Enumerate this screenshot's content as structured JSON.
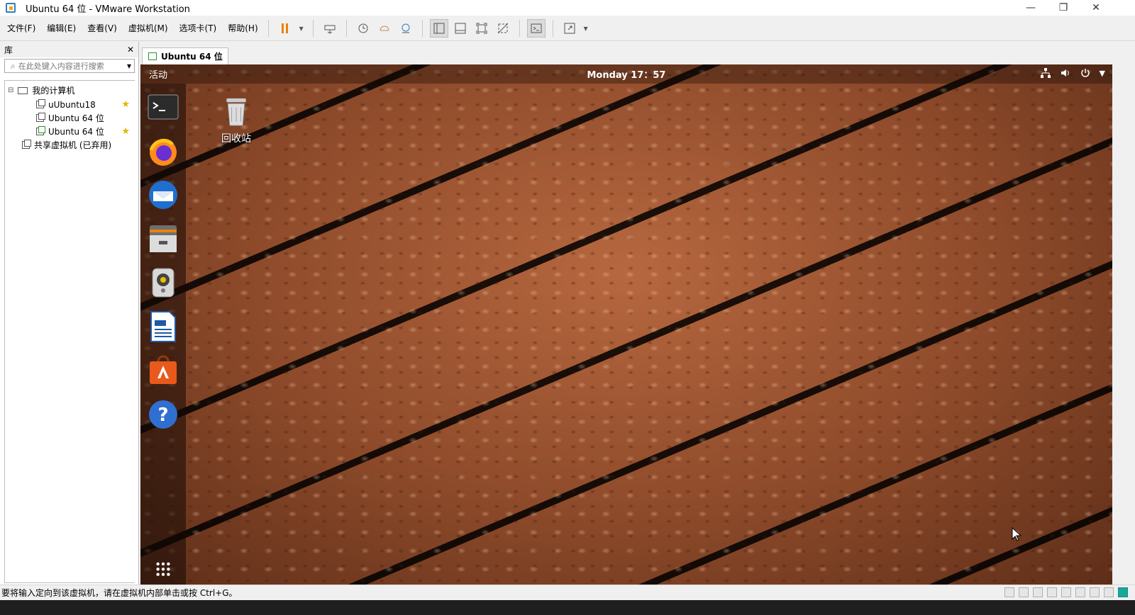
{
  "window": {
    "title": "Ubuntu 64 位 - VMware Workstation"
  },
  "menu": [
    "文件(F)",
    "编辑(E)",
    "查看(V)",
    "虚拟机(M)",
    "选项卡(T)",
    "帮助(H)"
  ],
  "library": {
    "title": "库",
    "search_placeholder": "在此处键入内容进行搜索",
    "tree": {
      "root": "我的计算机",
      "vms": [
        "uUbuntu18",
        "Ubuntu 64 位",
        "Ubuntu 64 位"
      ],
      "shared": "共享虚拟机 (已弃用)"
    }
  },
  "vm_tab": {
    "label": "Ubuntu 64 位"
  },
  "guest": {
    "activities": "活动",
    "clock": "Monday 17：57",
    "desktop_icon_label": "回收站",
    "dock_apps": [
      "terminal-icon",
      "firefox-icon",
      "thunderbird-icon",
      "files-icon",
      "rhythmbox-icon",
      "libreoffice-writer-icon",
      "ubuntu-software-icon",
      "help-icon"
    ]
  },
  "status": {
    "message": "要将输入定向到该虚拟机，请在虚拟机内部单击或按 Ctrl+G。"
  },
  "colors": {
    "accent": "#e8810f",
    "wallpaper": "#a05a33"
  }
}
